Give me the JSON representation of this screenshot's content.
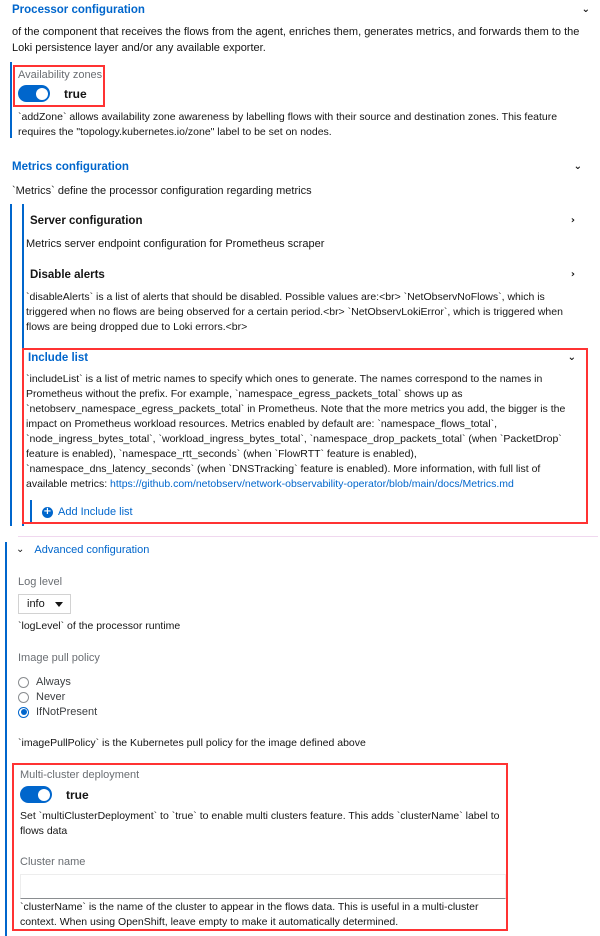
{
  "processor": {
    "title": "Processor configuration",
    "chevron": "⌄",
    "description": "of the component that receives the flows from the agent, enriches them, generates metrics, and forwards them to the Loki persistence layer and/or any available exporter."
  },
  "availability_zones": {
    "label": "Availability zones",
    "toggle_value": "true",
    "toggle_on": true,
    "helper": "`addZone` allows availability zone awareness by labelling flows with their source and destination zones. This feature requires the \"topology.kubernetes.io/zone\" label to be set on nodes.",
    "highlight_color": "#ff3333"
  },
  "metrics": {
    "title": "Metrics configuration",
    "chevron": "⌄",
    "description": "`Metrics` define the processor configuration regarding metrics",
    "server": {
      "title": "Server configuration",
      "chevron": "›",
      "description": "Metrics server endpoint configuration for Prometheus scraper"
    },
    "disable_alerts": {
      "title": "Disable alerts",
      "chevron": "›",
      "description": "`disableAlerts` is a list of alerts that should be disabled. Possible values are:<br> `NetObservNoFlows`, which is triggered when no flows are being observed for a certain period.<br> `NetObservLokiError`, which is triggered when flows are being dropped due to Loki errors.<br>"
    },
    "include_list": {
      "title": "Include list",
      "chevron": "⌄",
      "description_part1": "`includeList` is a list of metric names to specify which ones to generate. The names correspond to the names in Prometheus without the prefix. For example, `namespace_egress_packets_total` shows up as `netobserv_namespace_egress_packets_total` in Prometheus. Note that the more metrics you add, the bigger is the impact on Prometheus workload resources. Metrics enabled by default are: `namespace_flows_total`, `node_ingress_bytes_total`, `workload_ingress_bytes_total`, `namespace_drop_packets_total` (when `PacketDrop` feature is enabled), `namespace_rtt_seconds` (when `FlowRTT` feature is enabled), `namespace_dns_latency_seconds` (when `DNSTracking` feature is enabled). More information, with full list of available metrics: ",
      "link_text": "https://github.com/netobserv/network-observability-operator/blob/main/docs/Metrics.md",
      "add_button_label": "Add Include list",
      "add_button_icon": "plus-circle-icon",
      "highlight_color": "#ff3333"
    }
  },
  "advanced": {
    "title": "Advanced configuration",
    "chevron": "⌄",
    "log_level": {
      "label": "Log level",
      "value": "info",
      "helper": "`logLevel` of the processor runtime"
    },
    "image_pull_policy": {
      "label": "Image pull policy",
      "options": [
        {
          "label": "Always",
          "selected": false
        },
        {
          "label": "Never",
          "selected": false
        },
        {
          "label": "IfNotPresent",
          "selected": true
        }
      ],
      "helper": "`imagePullPolicy` is the Kubernetes pull policy for the image defined above"
    },
    "multi_cluster": {
      "label": "Multi-cluster deployment",
      "toggle_value": "true",
      "toggle_on": true,
      "helper": "Set `multiClusterDeployment` to `true` to enable multi clusters feature. This adds `clusterName` label to flows data",
      "cluster_name_label": "Cluster name",
      "cluster_name_value": "",
      "cluster_name_placeholder": "",
      "cluster_name_helper": "`clusterName` is the name of the cluster to appear in the flows data. This is useful in a multi-cluster context. When using OpenShift, leave empty to make it automatically determined.",
      "highlight_color": "#ff3333"
    }
  }
}
